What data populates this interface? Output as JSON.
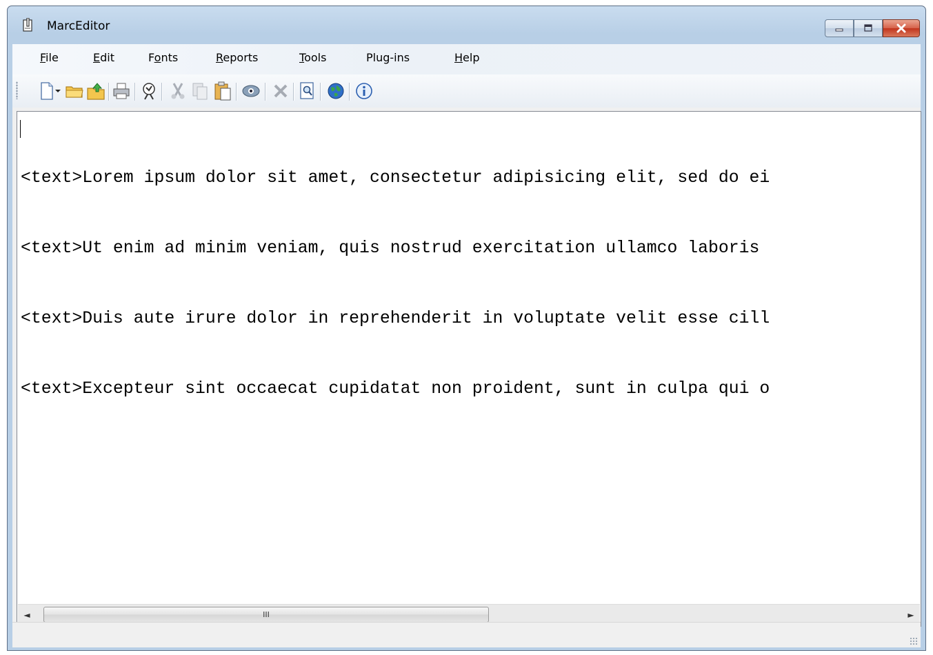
{
  "window": {
    "title": "MarcEditor"
  },
  "caption_buttons": [
    "minimize-icon",
    "maximize-icon",
    "close-icon"
  ],
  "menu": [
    {
      "label": "File",
      "accel": "F",
      "rest": "ile",
      "pre": ""
    },
    {
      "label": "Edit",
      "accel": "E",
      "rest": "dit",
      "pre": ""
    },
    {
      "label": "Fonts",
      "accel": "o",
      "rest": "nts",
      "pre": "F"
    },
    {
      "label": "Reports",
      "accel": "R",
      "rest": "eports",
      "pre": ""
    },
    {
      "label": "Tools",
      "accel": "T",
      "rest": "ools",
      "pre": ""
    },
    {
      "label": "Plug-ins",
      "accel": "",
      "rest": "Plug-ins",
      "pre": ""
    },
    {
      "label": "Help",
      "accel": "H",
      "rest": "elp",
      "pre": ""
    }
  ],
  "toolbar": {
    "icons": [
      "new-document-icon",
      "dropdown-arrow-icon",
      "open-folder-icon",
      "save-icon",
      "print-icon",
      "macro-icon",
      "cut-icon",
      "copy-icon",
      "paste-icon",
      "view-icon",
      "delete-icon",
      "find-icon",
      "web-globe-icon",
      "info-icon"
    ]
  },
  "editor": {
    "lines": [
      "<text>Lorem ipsum dolor sit amet, consectetur adipisicing elit, sed do ei",
      "<text>Ut enim ad minim veniam, quis nostrud exercitation ullamco laboris ",
      "<text>Duis aute irure dolor in reprehenderit in voluptate velit esse cill",
      "<text>Excepteur sint occaecat cupidatat non proident, sunt in culpa qui o"
    ]
  },
  "scrollbar": {
    "thumb_label": "III",
    "left_arrow": "◄",
    "right_arrow": "►"
  },
  "colors": {
    "title_gradient": "#b8cfe6",
    "close_button": "#c2351d",
    "client_bg": "#f0f0f0"
  }
}
